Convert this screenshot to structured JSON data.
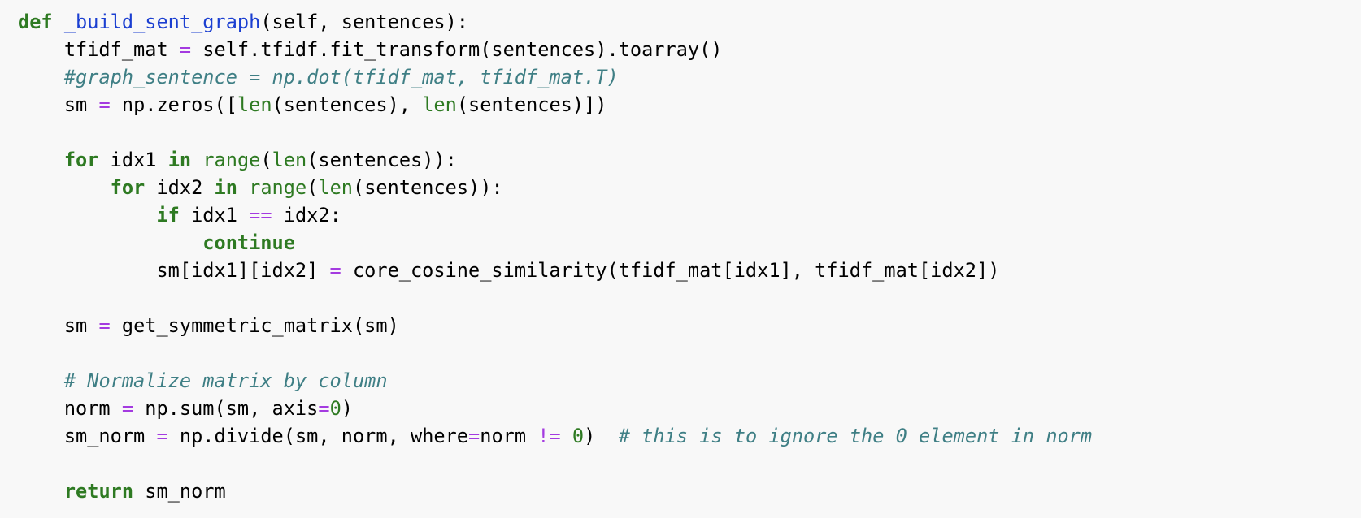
{
  "colors": {
    "background": "#f8f8f8",
    "default": "#000000",
    "keyword": "#2e7a22",
    "builtin": "#2e7a22",
    "operator": "#a43be0",
    "function_name": "#1b3fd1",
    "comment": "#3f7f85",
    "number": "#2e7a22"
  },
  "code_lines": [
    [
      {
        "t": "def",
        "k": "keyword"
      },
      {
        "t": " "
      },
      {
        "t": "_build_sent_graph",
        "k": "function_name"
      },
      {
        "t": "(self, sentences):"
      }
    ],
    [
      {
        "t": "    tfidf_mat "
      },
      {
        "t": "=",
        "k": "operator"
      },
      {
        "t": " self.tfidf.fit_transform(sentences).toarray()"
      }
    ],
    [
      {
        "t": "    "
      },
      {
        "t": "#graph_sentence = np.dot(tfidf_mat, tfidf_mat.T)",
        "k": "comment"
      }
    ],
    [
      {
        "t": "    sm "
      },
      {
        "t": "=",
        "k": "operator"
      },
      {
        "t": " np.zeros(["
      },
      {
        "t": "len",
        "k": "builtin"
      },
      {
        "t": "(sentences), "
      },
      {
        "t": "len",
        "k": "builtin"
      },
      {
        "t": "(sentences)])"
      }
    ],
    [],
    [
      {
        "t": "    "
      },
      {
        "t": "for",
        "k": "keyword"
      },
      {
        "t": " idx1 "
      },
      {
        "t": "in",
        "k": "keyword"
      },
      {
        "t": " "
      },
      {
        "t": "range",
        "k": "builtin"
      },
      {
        "t": "("
      },
      {
        "t": "len",
        "k": "builtin"
      },
      {
        "t": "(sentences)):"
      }
    ],
    [
      {
        "t": "        "
      },
      {
        "t": "for",
        "k": "keyword"
      },
      {
        "t": " idx2 "
      },
      {
        "t": "in",
        "k": "keyword"
      },
      {
        "t": " "
      },
      {
        "t": "range",
        "k": "builtin"
      },
      {
        "t": "("
      },
      {
        "t": "len",
        "k": "builtin"
      },
      {
        "t": "(sentences)):"
      }
    ],
    [
      {
        "t": "            "
      },
      {
        "t": "if",
        "k": "keyword"
      },
      {
        "t": " idx1 "
      },
      {
        "t": "==",
        "k": "operator"
      },
      {
        "t": " idx2:"
      }
    ],
    [
      {
        "t": "                "
      },
      {
        "t": "continue",
        "k": "keyword"
      }
    ],
    [
      {
        "t": "            sm[idx1][idx2] "
      },
      {
        "t": "=",
        "k": "operator"
      },
      {
        "t": " core_cosine_similarity(tfidf_mat[idx1], tfidf_mat[idx2])"
      }
    ],
    [],
    [
      {
        "t": "    sm "
      },
      {
        "t": "=",
        "k": "operator"
      },
      {
        "t": " get_symmetric_matrix(sm)"
      }
    ],
    [],
    [
      {
        "t": "    "
      },
      {
        "t": "# Normalize matrix by column",
        "k": "comment"
      }
    ],
    [
      {
        "t": "    norm "
      },
      {
        "t": "=",
        "k": "operator"
      },
      {
        "t": " np.sum(sm, axis"
      },
      {
        "t": "=",
        "k": "operator"
      },
      {
        "t": "0",
        "k": "number"
      },
      {
        "t": ")"
      }
    ],
    [
      {
        "t": "    sm_norm "
      },
      {
        "t": "=",
        "k": "operator"
      },
      {
        "t": " np.divide(sm, norm, where"
      },
      {
        "t": "=",
        "k": "operator"
      },
      {
        "t": "norm "
      },
      {
        "t": "!=",
        "k": "operator"
      },
      {
        "t": " "
      },
      {
        "t": "0",
        "k": "number"
      },
      {
        "t": ")  "
      },
      {
        "t": "# this is to ignore the 0 element in norm",
        "k": "comment"
      }
    ],
    [],
    [
      {
        "t": "    "
      },
      {
        "t": "return",
        "k": "keyword"
      },
      {
        "t": " sm_norm"
      }
    ]
  ]
}
